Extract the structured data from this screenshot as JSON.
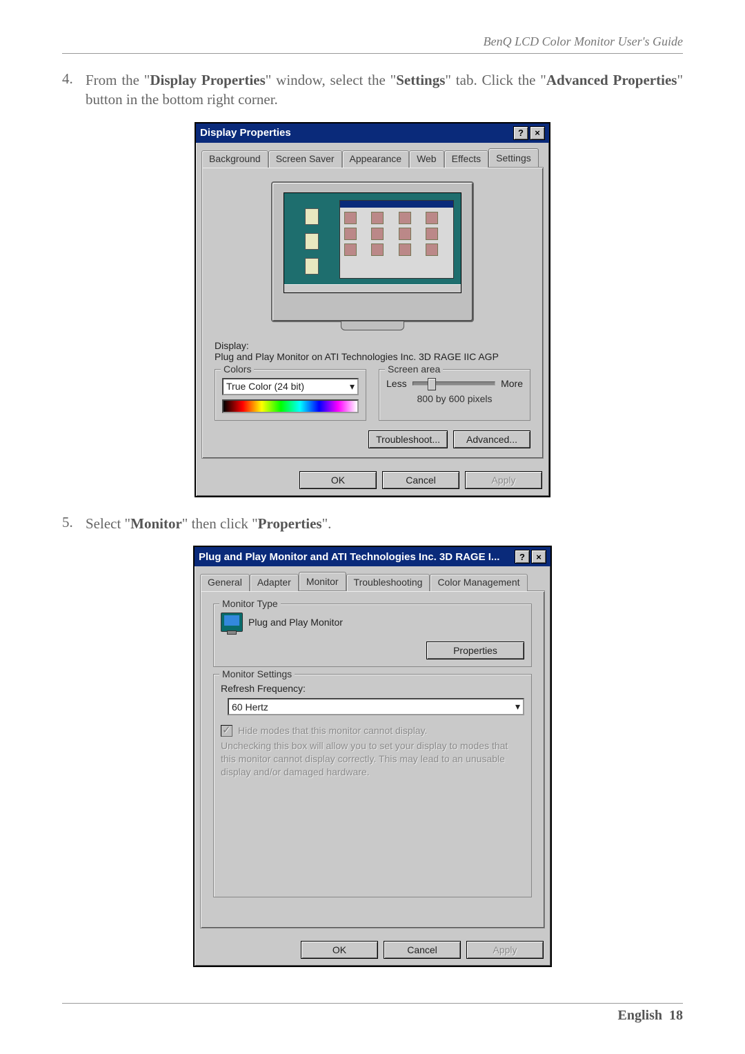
{
  "header": {
    "text": "BenQ LCD Color Monitor User's Guide"
  },
  "steps": {
    "s4": {
      "num": "4.",
      "pre": "From the \"",
      "b1": "Display Properties",
      "mid1": "\" window, select the \"",
      "b2": "Settings",
      "mid2": "\" tab. Click the \"",
      "b3": "Advanced Properties",
      "post": "\" button in the bottom right corner."
    },
    "s5": {
      "num": "5.",
      "pre": "Select \"",
      "b1": "Monitor",
      "mid1": "\" then click \"",
      "b2": "Properties",
      "post": "\"."
    }
  },
  "dlg1": {
    "title": "Display Properties",
    "tabs": {
      "background": "Background",
      "screensaver": "Screen Saver",
      "appearance": "Appearance",
      "web": "Web",
      "effects": "Effects",
      "settings": "Settings"
    },
    "display_label": "Display:",
    "display_value": "Plug and Play Monitor on ATI Technologies Inc. 3D RAGE IIC AGP",
    "colors_legend": "Colors",
    "colors_value": "True Color (24 bit)",
    "screen_legend": "Screen area",
    "less": "Less",
    "more": "More",
    "resolution": "800 by 600 pixels",
    "troubleshoot": "Troubleshoot...",
    "advanced": "Advanced...",
    "ok": "OK",
    "cancel": "Cancel",
    "apply": "Apply"
  },
  "dlg2": {
    "title": "Plug and Play Monitor and ATI Technologies Inc. 3D RAGE I...",
    "tabs": {
      "general": "General",
      "adapter": "Adapter",
      "monitor": "Monitor",
      "troubleshooting": "Troubleshooting",
      "colormgmt": "Color Management"
    },
    "monitor_type_legend": "Monitor Type",
    "monitor_name": "Plug and Play Monitor",
    "properties": "Properties",
    "settings_legend": "Monitor Settings",
    "refresh_label": "Refresh Frequency:",
    "refresh_value": "60 Hertz",
    "hide_modes": "Hide modes that this monitor cannot display.",
    "hint": "Unchecking this box will allow you to set your display to modes that this monitor cannot display correctly. This may lead to an unusable display and/or damaged hardware.",
    "ok": "OK",
    "cancel": "Cancel",
    "apply": "Apply"
  },
  "footer": {
    "lang": "English",
    "page": "18"
  }
}
